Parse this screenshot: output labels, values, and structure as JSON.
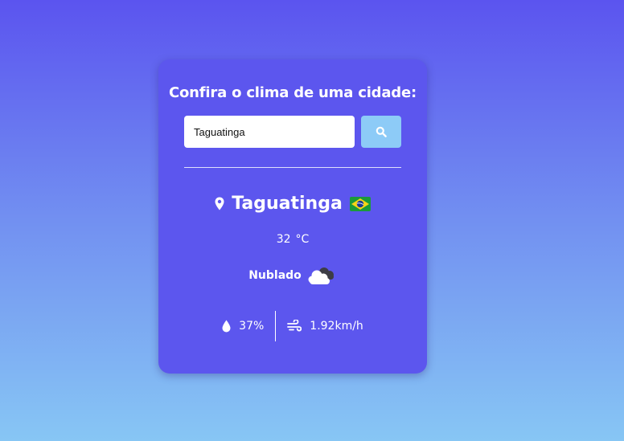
{
  "title": "Confira o clima de uma cidade:",
  "search": {
    "value": "Taguatinga",
    "placeholder": "",
    "button_icon": "search-icon"
  },
  "weather": {
    "city": "Taguatinga",
    "country_flag": "brazil-flag-icon",
    "temperature": "32",
    "unit": "°C",
    "description": "Nublado",
    "description_icon": "cloudy-icon",
    "humidity": "37%",
    "humidity_icon": "water-drop-icon",
    "wind": "1.92km/h",
    "wind_icon": "wind-icon"
  },
  "colors": {
    "card": "#5c56ee",
    "button": "#8dcbf7",
    "gradient_top": "#5b54ef",
    "gradient_bottom": "#87c6f4"
  }
}
